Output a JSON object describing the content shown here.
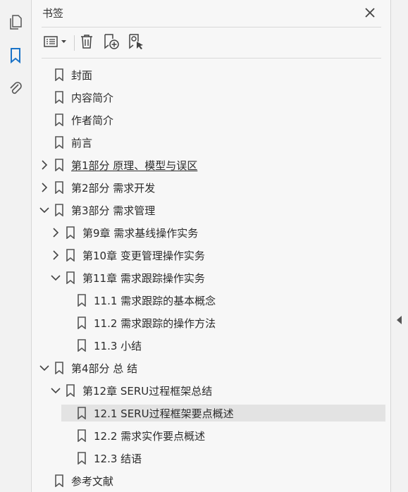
{
  "rail": {
    "items": [
      {
        "icon": "pages-icon"
      },
      {
        "icon": "bookmark-icon",
        "active": true
      },
      {
        "icon": "attachment-icon"
      }
    ]
  },
  "panel": {
    "title": "书签",
    "toolbar": [
      "options-menu-icon",
      "delete-icon",
      "new-bookmark-icon",
      "bookmark-from-selection-icon"
    ]
  },
  "bookmarks": [
    {
      "label": "封面",
      "level": 0,
      "expander": "none"
    },
    {
      "label": "内容简介",
      "level": 0,
      "expander": "none"
    },
    {
      "label": "作者简介",
      "level": 0,
      "expander": "none"
    },
    {
      "label": "前言",
      "level": 0,
      "expander": "none"
    },
    {
      "label": "第1部分 原理、模型与误区",
      "level": 0,
      "expander": "collapsed",
      "underline": true
    },
    {
      "label": "第2部分 需求开发",
      "level": 0,
      "expander": "collapsed"
    },
    {
      "label": "第3部分 需求管理",
      "level": 0,
      "expander": "expanded"
    },
    {
      "label": "第9章 需求基线操作实务",
      "level": 1,
      "expander": "collapsed"
    },
    {
      "label": "第10章 变更管理操作实务",
      "level": 1,
      "expander": "collapsed"
    },
    {
      "label": "第11章 需求跟踪操作实务",
      "level": 1,
      "expander": "expanded"
    },
    {
      "label": "11.1 需求跟踪的基本概念",
      "level": 2,
      "expander": "none"
    },
    {
      "label": "11.2 需求跟踪的操作方法",
      "level": 2,
      "expander": "none"
    },
    {
      "label": "11.3 小结",
      "level": 2,
      "expander": "none"
    },
    {
      "label": "第4部分 总 结",
      "level": 0,
      "expander": "expanded"
    },
    {
      "label": "第12章 SERU过程框架总结",
      "level": 1,
      "expander": "expanded"
    },
    {
      "label": "12.1 SERU过程框架要点概述",
      "level": 2,
      "expander": "none",
      "selected": true
    },
    {
      "label": "12.2 需求实作要点概述",
      "level": 2,
      "expander": "none"
    },
    {
      "label": "12.3 结语",
      "level": 2,
      "expander": "none"
    },
    {
      "label": "参考文献",
      "level": 0,
      "expander": "none"
    }
  ],
  "colors": {
    "accent": "#1a73c8",
    "icon": "#555555",
    "selection": "#e3e3e3"
  }
}
